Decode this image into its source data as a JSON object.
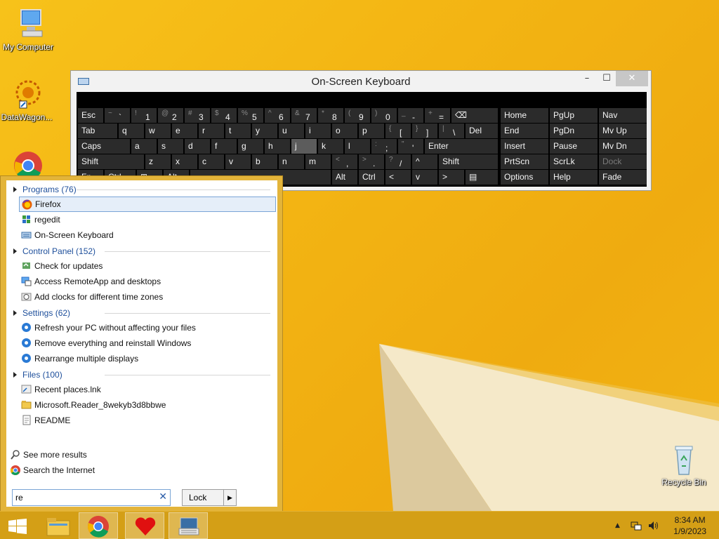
{
  "desktop": {
    "icons": [
      {
        "label": "My Computer",
        "icon": "computer-icon"
      },
      {
        "label": "DataWagon...",
        "icon": "datawagon-icon"
      },
      {
        "label": "Recycle Bin",
        "icon": "recycle-bin-icon"
      }
    ]
  },
  "osk": {
    "title": "On-Screen Keyboard",
    "window_buttons": {
      "minimize": "–",
      "maximize": "☐",
      "close": "✕"
    },
    "rows": [
      [
        "Esc",
        "~ `",
        "! 1",
        "@ 2",
        "# 3",
        "$ 4",
        "% 5",
        "^ 6",
        "& 7",
        "* 8",
        "( 9",
        ") 0",
        "_ -",
        "+ =",
        "⌫"
      ],
      [
        "Tab",
        "q",
        "w",
        "e",
        "r",
        "t",
        "y",
        "u",
        "i",
        "o",
        "p",
        "{ [",
        "} ]",
        "| \\",
        "Del"
      ],
      [
        "Caps",
        "a",
        "s",
        "d",
        "f",
        "g",
        "h",
        "j",
        "k",
        "l",
        ": ;",
        "\" '",
        "Enter"
      ],
      [
        "Shift",
        "z",
        "x",
        "c",
        "v",
        "b",
        "n",
        "m",
        "< ,",
        "> .",
        "? /",
        "^",
        "Shift"
      ],
      [
        "Fn",
        "Ctrl",
        "⊞",
        "Alt",
        "",
        "Alt",
        "Ctrl",
        "<",
        "v",
        ">",
        "▤"
      ]
    ],
    "nav_keys": [
      [
        "Home",
        "PgUp",
        "Nav"
      ],
      [
        "End",
        "PgDn",
        "Mv Up"
      ],
      [
        "Insert",
        "Pause",
        "Mv Dn"
      ],
      [
        "PrtScn",
        "ScrLk",
        "Dock"
      ],
      [
        "Options",
        "Help",
        "Fade"
      ]
    ],
    "highlighted_key": "j"
  },
  "search": {
    "groups": [
      {
        "label": "Programs (76)",
        "items": [
          {
            "label": "Firefox",
            "icon": "firefox-icon",
            "selected": true
          },
          {
            "label": "regedit",
            "icon": "regedit-icon"
          },
          {
            "label": "On-Screen Keyboard",
            "icon": "keyboard-icon"
          }
        ]
      },
      {
        "label": "Control Panel (152)",
        "items": [
          {
            "label": "Check for updates",
            "icon": "update-icon"
          },
          {
            "label": "Access RemoteApp and desktops",
            "icon": "remoteapp-icon"
          },
          {
            "label": "Add clocks for different time zones",
            "icon": "clock-icon"
          }
        ]
      },
      {
        "label": "Settings (62)",
        "items": [
          {
            "label": "Refresh your PC without affecting your files",
            "icon": "gear-icon"
          },
          {
            "label": "Remove everything and reinstall Windows",
            "icon": "gear-icon"
          },
          {
            "label": "Rearrange multiple displays",
            "icon": "gear-icon"
          }
        ]
      },
      {
        "label": "Files (100)",
        "items": [
          {
            "label": "Recent places.lnk",
            "icon": "shortcut-icon"
          },
          {
            "label": "Microsoft.Reader_8wekyb3d8bbwe",
            "icon": "folder-icon"
          },
          {
            "label": "README",
            "icon": "document-icon"
          }
        ]
      }
    ],
    "see_more": "See more results",
    "search_internet": "Search the Internet",
    "query": "re",
    "clear": "✕",
    "lock_label": "Lock",
    "lock_arrow": "▶"
  },
  "taskbar": {
    "apps": [
      "start-icon",
      "file-explorer-icon",
      "chrome-icon",
      "heart-app-icon",
      "osk-app-icon"
    ],
    "time": "8:34 AM",
    "date": "1/9/2023",
    "tray_arrow": "▲"
  },
  "colors": {
    "accent": "#f2b414",
    "osk_key": "#2b2b2b",
    "selection": "#e5eef9"
  }
}
